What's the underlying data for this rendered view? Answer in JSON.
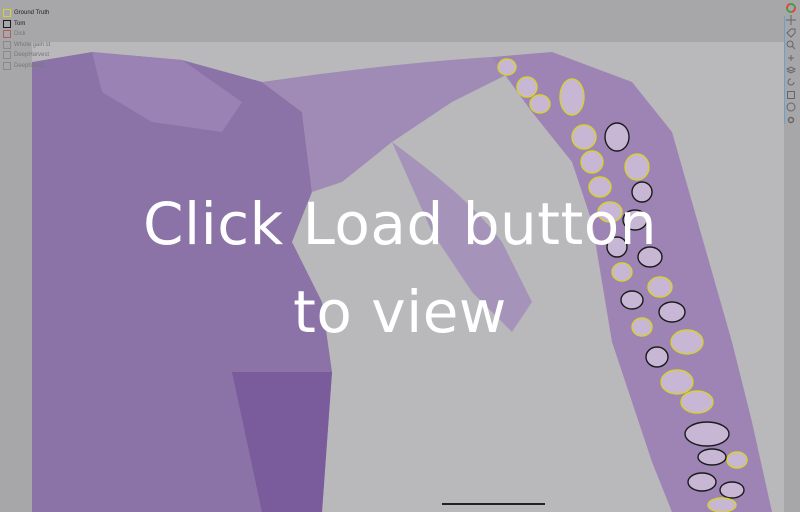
{
  "legend": {
    "items": [
      {
        "label": "Ground Truth",
        "color": "#e6e23a",
        "dim": false
      },
      {
        "label": "Tom",
        "color": "#1a1a1a",
        "dim": false
      },
      {
        "label": "Dick",
        "color": "#b06060",
        "dim": true
      },
      {
        "label": "Whole gain st",
        "color": "#8a8a8a",
        "dim": true
      },
      {
        "label": "DeepHarvest",
        "color": "#8a8a8a",
        "dim": true
      },
      {
        "label": "DeepharvC",
        "color": "#8a8a8a",
        "dim": true
      }
    ]
  },
  "toolbar": {
    "icons": [
      "color-wheel-icon",
      "move-icon",
      "tag-icon",
      "zoom-icon",
      "point-icon",
      "layers-icon",
      "rotate-icon",
      "save-icon",
      "help-icon",
      "settings-icon"
    ]
  },
  "overlay": {
    "line1": "Click Load button",
    "line2": "to view"
  }
}
